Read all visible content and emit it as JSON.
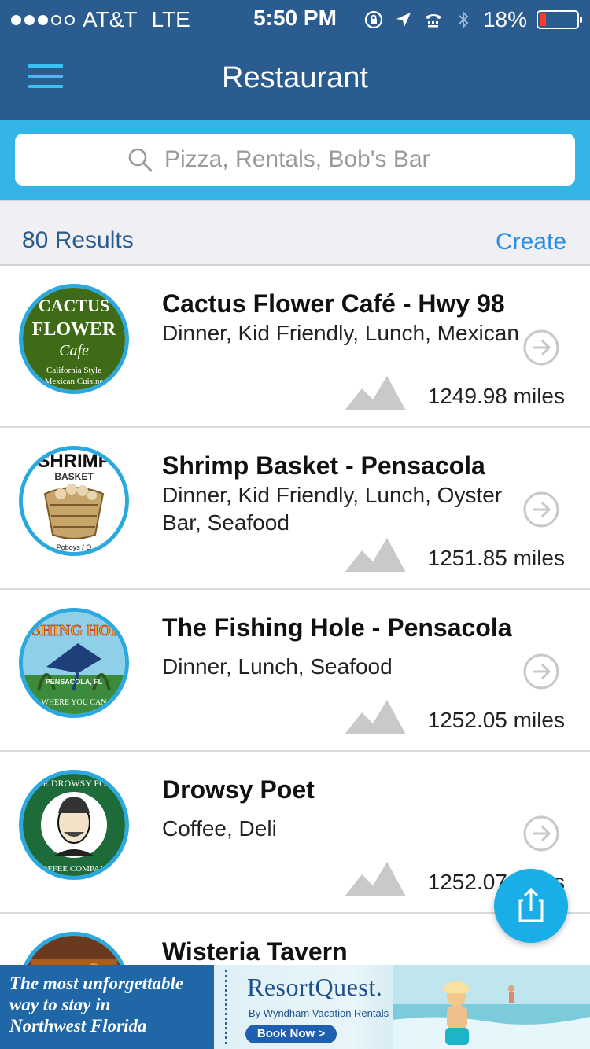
{
  "status_bar": {
    "carrier": "AT&T",
    "network": "LTE",
    "time": "5:50 PM",
    "battery_percent_text": "18%",
    "battery_level": 0.18,
    "signal_bars_filled": 3,
    "signal_bars_total": 5
  },
  "nav": {
    "title": "Restaurant",
    "menu_icon": "hamburger-menu-icon"
  },
  "search": {
    "placeholder": "Pizza, Rentals, Bob's Bar",
    "value": ""
  },
  "results": {
    "count_label": "80 Results",
    "create_label": "Create"
  },
  "restaurants": [
    {
      "name": "Cactus Flower Café - Hwy 98",
      "categories": "Dinner, Kid Friendly, Lunch, Mexican",
      "distance": "1249.98 miles",
      "logo_text": [
        "CACTUS",
        "FLOWER",
        "Cafe",
        "California Style",
        "Mexican Cuisine"
      ]
    },
    {
      "name": "Shrimp Basket - Pensacola",
      "categories": "Dinner, Kid Friendly, Lunch, Oyster Bar, Seafood",
      "distance": "1251.85 miles",
      "logo_text": [
        "SHRIMP",
        "BASKET",
        "Poboys / O"
      ]
    },
    {
      "name": "The Fishing Hole - Pensacola",
      "categories": "Dinner, Lunch, Seafood",
      "distance": "1252.05 miles",
      "logo_text": [
        "FISHING HOLE",
        "PENSACOLA, FL",
        "WHERE YOU CAN"
      ]
    },
    {
      "name": "Drowsy Poet",
      "categories": "Coffee, Deli",
      "distance": "1252.07 miles",
      "logo_text": [
        "THE DROWSY POET",
        "COFFEE COMPANY"
      ]
    },
    {
      "name": "Wisteria Tavern",
      "categories": "",
      "distance": ""
    }
  ],
  "ad": {
    "tagline": [
      "The most unforgettable",
      "way to stay in",
      "Northwest Florida"
    ],
    "brand": "ResortQuest.",
    "sub": "By Wyndham Vacation Rentals",
    "button": "Book Now >"
  },
  "colors": {
    "nav_blue": "#2b5c8f",
    "search_band": "#33b5e5",
    "accent_cyan": "#35c3f3",
    "link_blue": "#2a8fe0",
    "fab_blue": "#19aee8"
  }
}
